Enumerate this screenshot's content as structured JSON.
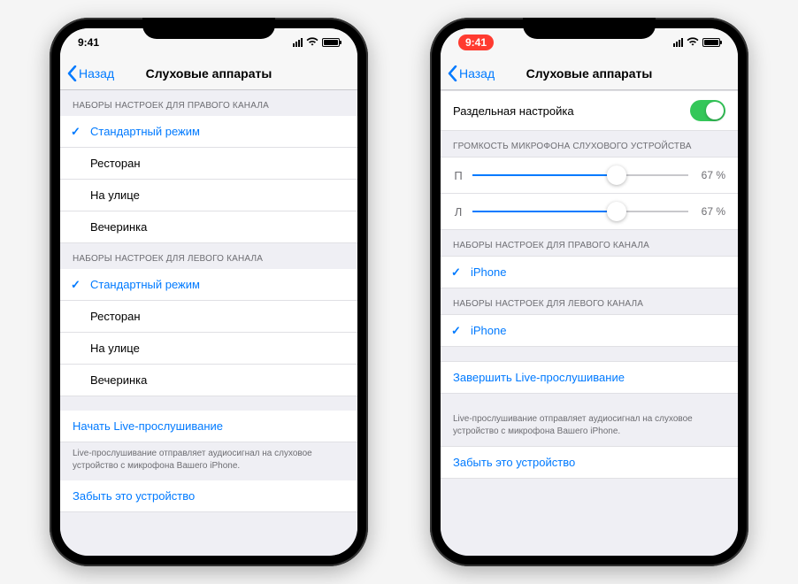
{
  "phone1": {
    "time": "9:41",
    "back_label": "Назад",
    "title": "Слуховые аппараты",
    "right_header": "НАБОРЫ НАСТРОЕК ДЛЯ ПРАВОГО КАНАЛА",
    "right_presets": [
      {
        "label": "Стандартный режим",
        "selected": true
      },
      {
        "label": "Ресторан",
        "selected": false
      },
      {
        "label": "На улице",
        "selected": false
      },
      {
        "label": "Вечеринка",
        "selected": false
      }
    ],
    "left_header": "НАБОРЫ НАСТРОЕК ДЛЯ ЛЕВОГО КАНАЛА",
    "left_presets": [
      {
        "label": "Стандартный режим",
        "selected": true
      },
      {
        "label": "Ресторан",
        "selected": false
      },
      {
        "label": "На улице",
        "selected": false
      },
      {
        "label": "Вечеринка",
        "selected": false
      }
    ],
    "live_start": "Начать Live-прослушивание",
    "live_note": "Live-прослушивание отправляет аудиосигнал на слуховое устройство с микрофона Вашего iPhone.",
    "forget": "Забыть это устройство"
  },
  "phone2": {
    "time": "9:41",
    "back_label": "Назад",
    "title": "Слуховые аппараты",
    "split_label": "Раздельная настройка",
    "split_on": true,
    "volume_header": "ГРОМКОСТЬ МИКРОФОНА СЛУХОВОГО УСТРОЙСТВА",
    "sliders": [
      {
        "side": "П",
        "value": 67,
        "text": "67 %"
      },
      {
        "side": "Л",
        "value": 67,
        "text": "67 %"
      }
    ],
    "right_header": "НАБОРЫ НАСТРОЕК ДЛЯ ПРАВОГО КАНАЛА",
    "right_preset": "iPhone",
    "left_header": "НАБОРЫ НАСТРОЕК ДЛЯ ЛЕВОГО КАНАЛА",
    "left_preset": "iPhone",
    "live_stop": "Завершить Live-прослушивание",
    "live_note": "Live-прослушивание отправляет аудиосигнал на слуховое устройство с микрофона Вашего iPhone.",
    "forget": "Забыть это устройство"
  }
}
